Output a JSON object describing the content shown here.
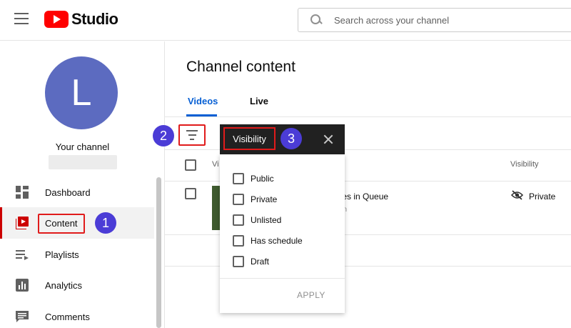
{
  "header": {
    "logo_text": "Studio",
    "search_placeholder": "Search across your channel"
  },
  "sidebar": {
    "avatar_letter": "L",
    "channel_label": "Your channel",
    "items": [
      {
        "label": "Dashboard",
        "icon": "dashboard-icon"
      },
      {
        "label": "Content",
        "icon": "content-icon",
        "active": true
      },
      {
        "label": "Playlists",
        "icon": "playlists-icon"
      },
      {
        "label": "Analytics",
        "icon": "analytics-icon"
      },
      {
        "label": "Comments",
        "icon": "comments-icon"
      }
    ]
  },
  "main": {
    "title": "Channel content",
    "tabs": [
      {
        "label": "Videos",
        "active": true
      },
      {
        "label": "Live"
      }
    ],
    "table": {
      "col_video_partial": "Vi",
      "col_visibility": "Visibility",
      "rows": [
        {
          "title_partial": "tties in Queue",
          "subtitle_partial": "tion",
          "visibility": "Private"
        }
      ]
    }
  },
  "filter_menu": {
    "title": "Visibility",
    "options": [
      "Public",
      "Private",
      "Unlisted",
      "Has schedule",
      "Draft"
    ],
    "apply_label": "APPLY"
  },
  "annotations": {
    "step1": "1",
    "step2": "2",
    "step3": "3"
  },
  "colors": {
    "brand_red": "#ff0000",
    "accent_blue": "#065fd4",
    "annotation_red": "#e01b1b",
    "badge_purple": "#4b3cd6",
    "avatar": "#5c6bc0"
  }
}
